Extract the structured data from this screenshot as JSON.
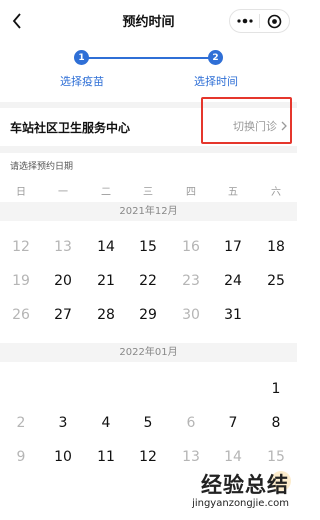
{
  "nav": {
    "title": "预约时间",
    "back_icon": "chevron-left-icon",
    "more_icon": "more-dots-icon",
    "close_icon": "target-circle-icon"
  },
  "steps": {
    "accent_color": "#2f6fd6",
    "items": [
      {
        "number": "1",
        "label": "选择疫苗"
      },
      {
        "number": "2",
        "label": "选择时间"
      }
    ]
  },
  "clinic": {
    "name": "车站社区卫生服务中心",
    "switch_label": "切换门诊",
    "switch_icon": "chevron-right-icon",
    "highlight_color": "#e5362c"
  },
  "calendar": {
    "hint": "请选择预约日期",
    "weekdays": [
      "日",
      "一",
      "二",
      "三",
      "四",
      "五",
      "六"
    ],
    "months": [
      {
        "title": "2021年12月",
        "weeks": [
          [
            {
              "d": "12",
              "on": false
            },
            {
              "d": "13",
              "on": false
            },
            {
              "d": "14",
              "on": true
            },
            {
              "d": "15",
              "on": true
            },
            {
              "d": "16",
              "on": false
            },
            {
              "d": "17",
              "on": true
            },
            {
              "d": "18",
              "on": true
            }
          ],
          [
            {
              "d": "19",
              "on": false
            },
            {
              "d": "20",
              "on": true
            },
            {
              "d": "21",
              "on": true
            },
            {
              "d": "22",
              "on": true
            },
            {
              "d": "23",
              "on": false
            },
            {
              "d": "24",
              "on": true
            },
            {
              "d": "25",
              "on": true
            }
          ],
          [
            {
              "d": "26",
              "on": false
            },
            {
              "d": "27",
              "on": true
            },
            {
              "d": "28",
              "on": true
            },
            {
              "d": "29",
              "on": true
            },
            {
              "d": "30",
              "on": false
            },
            {
              "d": "31",
              "on": true
            },
            {
              "d": "",
              "on": false
            }
          ]
        ]
      },
      {
        "title": "2022年01月",
        "weeks": [
          [
            {
              "d": "",
              "on": false
            },
            {
              "d": "",
              "on": false
            },
            {
              "d": "",
              "on": false
            },
            {
              "d": "",
              "on": false
            },
            {
              "d": "",
              "on": false
            },
            {
              "d": "",
              "on": false
            },
            {
              "d": "1",
              "on": true
            }
          ],
          [
            {
              "d": "2",
              "on": false
            },
            {
              "d": "3",
              "on": true
            },
            {
              "d": "4",
              "on": true
            },
            {
              "d": "5",
              "on": true
            },
            {
              "d": "6",
              "on": false
            },
            {
              "d": "7",
              "on": true
            },
            {
              "d": "8",
              "on": true
            }
          ],
          [
            {
              "d": "9",
              "on": false
            },
            {
              "d": "10",
              "on": true
            },
            {
              "d": "11",
              "on": true
            },
            {
              "d": "12",
              "on": true
            },
            {
              "d": "13",
              "on": false
            },
            {
              "d": "14",
              "on": false
            },
            {
              "d": "15",
              "on": false
            }
          ]
        ]
      }
    ]
  },
  "watermark": {
    "title": "经验总结",
    "url": "jingyanzongjie.com"
  }
}
